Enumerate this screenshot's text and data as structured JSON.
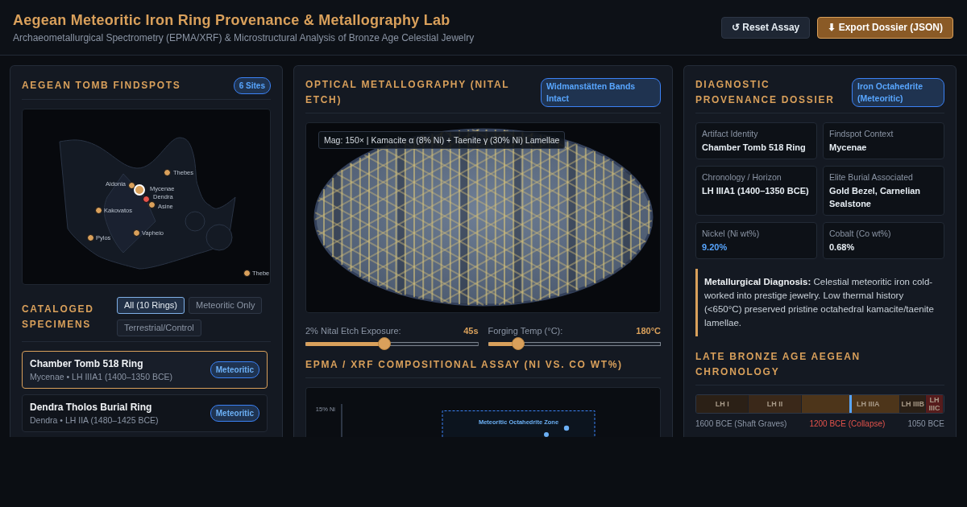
{
  "header": {
    "title": "Aegean Meteoritic Iron Ring Provenance & Metallography Lab",
    "subtitle": "Archaeometallurgical Spectrometry (EPMA/XRF) & Microstructural Analysis of Bronze Age Celestial Jewelry",
    "buttons": [
      {
        "label": "↺ Reset Assay",
        "kind": "secondary"
      },
      {
        "label": "⬇ Export Dossier (JSON)",
        "kind": "primary"
      }
    ]
  },
  "findspots": {
    "title": "AEGEAN TOMB FINDSPOTS",
    "badge": "6 Sites",
    "sites": [
      {
        "name": "Thebes",
        "color": "#d9a05b",
        "selected": false
      },
      {
        "name": "Aidonia",
        "color": "#d9a05b",
        "selected": false
      },
      {
        "name": "Mycenae",
        "color": "#d9a05b",
        "selected": true
      },
      {
        "name": "Dendra",
        "color": "#e5534b",
        "selected": false
      },
      {
        "name": "Asine",
        "color": "#d9a05b",
        "selected": false
      },
      {
        "name": "Kakovatos",
        "color": "#d9a05b",
        "selected": false
      },
      {
        "name": "Vapheio",
        "color": "#d9a05b",
        "selected": false
      },
      {
        "name": "Pylos",
        "color": "#d9a05b",
        "selected": false
      },
      {
        "name": "Thebe",
        "color": "#d9a05b",
        "selected": false
      }
    ]
  },
  "specimens": {
    "title": "CATALOGED SPECIMENS",
    "filters": [
      {
        "label": "All (10 Rings)",
        "selected": true
      },
      {
        "label": "Meteoritic Only",
        "selected": false
      },
      {
        "label": "Terrestrial/Control",
        "selected": false
      }
    ],
    "items": [
      {
        "name": "Chamber Tomb 518 Ring",
        "detail": "Mycenae • LH IIIA1 (1400–1350 BCE)",
        "tag": "Meteoritic",
        "selected": true
      },
      {
        "name": "Dendra Tholos Burial Ring",
        "detail": "Dendra • LH IIA (1480–1425 BCE)",
        "tag": "Meteoritic",
        "selected": false
      }
    ]
  },
  "metallography": {
    "title": "OPTICAL METALLOGRAPHY (NITAL ETCH)",
    "badge": "Widmanstätten Bands Intact",
    "caption": "Mag: 150× | Kamacite α (8% Ni) + Taenite γ (30% Ni) Lamellae",
    "sliders": [
      {
        "label": "2% Nital Etch Exposure:",
        "value": "45s",
        "level": 0.455
      },
      {
        "label": "Forging Temp (°C):",
        "value": "180°C",
        "level": 0.177
      }
    ]
  },
  "assay": {
    "title": "EPMA / XRF COMPOSITIONAL ASSAY (NI VS. CO WT%)",
    "y_tick": "15% Ni",
    "zone_label": "Meteoritic Octahedrite Zone"
  },
  "dossier": {
    "title": "DIAGNOSTIC PROVENANCE DOSSIER",
    "badge": "Iron Octahedrite (Meteoritic)",
    "fields": [
      {
        "label": "Artifact Identity",
        "value": "Chamber Tomb 518 Ring",
        "highlight": false
      },
      {
        "label": "Findspot Context",
        "value": "Mycenae",
        "highlight": false
      },
      {
        "label": "Chronology / Horizon",
        "value": "LH IIIA1 (1400–1350 BCE)",
        "highlight": false
      },
      {
        "label": "Elite Burial Associated",
        "value": "Gold Bezel, Carnelian Sealstone",
        "highlight": false
      },
      {
        "label": "Nickel (Ni wt%)",
        "value": "9.20%",
        "highlight": true
      },
      {
        "label": "Cobalt (Co wt%)",
        "value": "0.68%",
        "highlight": false
      }
    ],
    "diagnosis": "**Metallurgical Diagnosis:** Celestial meteoritic iron cold-worked into prestige jewelry. Low thermal history (<650°C) preserved pristine octahedral kamacite/taenite lamellae."
  },
  "chronology": {
    "title": "LATE BRONZE AGE AEGEAN CHRONOLOGY",
    "periods": [
      {
        "label": "LH I",
        "color": "#2b2016"
      },
      {
        "label": "LH II",
        "color": "#3a2819"
      },
      {
        "label": "LH IIIA",
        "color": "#4d351a"
      },
      {
        "label": "LH IIIB",
        "color": "#2b2016"
      },
      {
        "label": "LH IIIC",
        "color": "#561c1c"
      }
    ],
    "marker": {
      "level": 0.625
    },
    "scale": [
      {
        "label": "1600 BCE (Shaft Graves)",
        "color": "#8b95a5"
      },
      {
        "label": "1200 BCE (Collapse)",
        "color": "#e5534b"
      },
      {
        "label": "1050 BCE",
        "color": "#8b95a5"
      }
    ]
  }
}
